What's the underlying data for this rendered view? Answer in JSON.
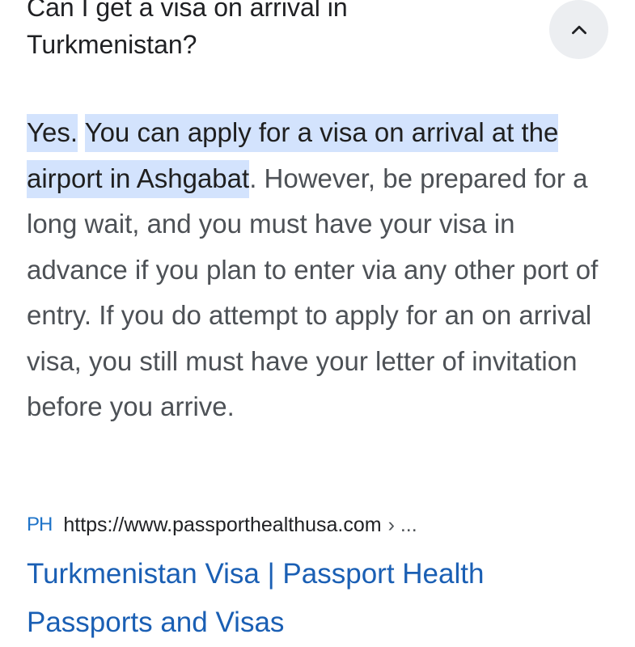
{
  "question": {
    "text": "Can I get a visa on arrival in Turkmenistan?"
  },
  "collapse_button": {
    "icon": "chevron-up-icon"
  },
  "answer": {
    "highlight_1": "Yes.",
    "highlight_2": "You can apply for a visa on arrival at the airport in Ashgabat",
    "rest": ". However, be prepared for a long wait, and you must have your visa in advance if you plan to enter via any other port of entry. If you do attempt to apply for an on arrival visa, you still must have your letter of invitation before you arrive."
  },
  "source": {
    "favicon_text": "PH",
    "url": "https://www.passporthealthusa.com",
    "breadcrumb": "› ..."
  },
  "result": {
    "title": "Turkmenistan Visa | Passport Health Passports and Visas"
  },
  "colors": {
    "highlight": "#d3e3fd",
    "link": "#1a5fb4",
    "body_text": "#4d5156",
    "favicon": "#1e73c8"
  }
}
